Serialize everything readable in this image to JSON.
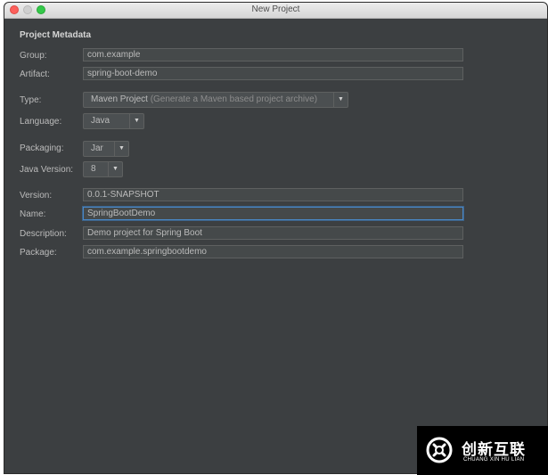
{
  "window": {
    "title": "New Project"
  },
  "form": {
    "section_title": "Project Metadata",
    "group": {
      "label": "Group:",
      "value": "com.example"
    },
    "artifact": {
      "label": "Artifact:",
      "value": "spring-boot-demo"
    },
    "type": {
      "label": "Type:",
      "value": "Maven Project",
      "hint": "(Generate a Maven based project archive)"
    },
    "language": {
      "label": "Language:",
      "value": "Java"
    },
    "packaging": {
      "label": "Packaging:",
      "value": "Jar"
    },
    "java_version": {
      "label": "Java Version:",
      "value": "8"
    },
    "version": {
      "label": "Version:",
      "value": "0.0.1-SNAPSHOT"
    },
    "name": {
      "label": "Name:",
      "value": "SpringBootDemo"
    },
    "description": {
      "label": "Description:",
      "value": "Demo project for Spring Boot"
    },
    "package": {
      "label": "Package:",
      "value": "com.example.springbootdemo"
    }
  },
  "watermark": {
    "brand_cn": "创新互联",
    "brand_en": "CHUANG XIN HU LIAN"
  },
  "icons": {
    "dropdown": "chevron-down-icon",
    "close": "close-icon",
    "minimize": "minimize-icon",
    "zoom": "zoom-icon"
  },
  "colors": {
    "window_bg": "#3c3f41",
    "field_bg": "#45494a",
    "focus_border": "#4a88c7",
    "close_button": "#fc605c",
    "zoom_button": "#34c84a"
  }
}
